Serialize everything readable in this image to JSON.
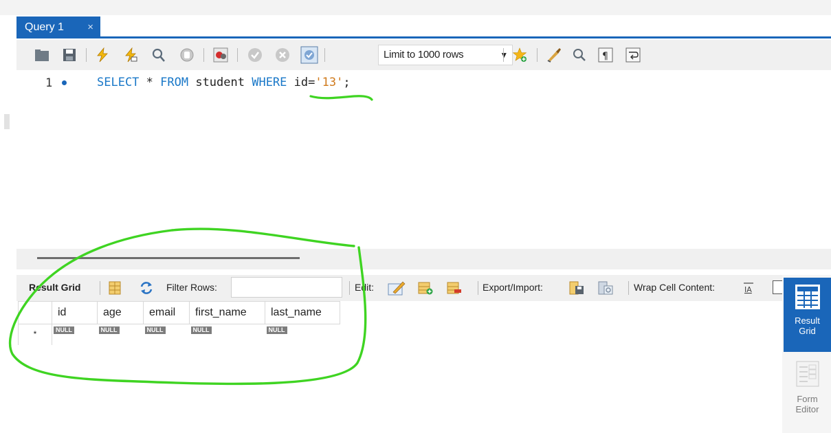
{
  "tab": {
    "label": "Query 1",
    "close": "×"
  },
  "toolbar": {
    "limit_select": "Limit to 1000 rows",
    "icons": [
      "open-folder-icon",
      "save-icon",
      "execute-icon",
      "execute-current-icon",
      "explain-icon",
      "stop-icon",
      "toggle-error-icon",
      "commit-icon",
      "rollback-icon",
      "autocommit-icon",
      "add-snippet-icon",
      "beautify-icon",
      "find-icon",
      "invisible-chars-icon",
      "wrap-lines-icon"
    ]
  },
  "editor": {
    "line_number": "1",
    "sql_select": "SELECT",
    "sql_star": " * ",
    "sql_from": "FROM",
    "sql_table": " student ",
    "sql_where": "WHERE",
    "sql_col": " id=",
    "sql_value": "'13'",
    "sql_end": ";"
  },
  "result_toolbar": {
    "result_grid": "Result Grid",
    "filter_rows": "Filter Rows:",
    "filter_value": "",
    "edit": "Edit:",
    "export_import": "Export/Import:",
    "wrap_cell": "Wrap Cell Content:"
  },
  "grid": {
    "columns": [
      "id",
      "age",
      "email",
      "first_name",
      "last_name"
    ],
    "row_marker": "*",
    "null_label": "NULL"
  },
  "side_panel": {
    "result_grid": "Result Grid",
    "form_editor": "Form Editor"
  },
  "colors": {
    "accent": "#1a66b9",
    "keyword": "#1a78c8",
    "string": "#d07a1c",
    "annotation": "#3fd422"
  }
}
